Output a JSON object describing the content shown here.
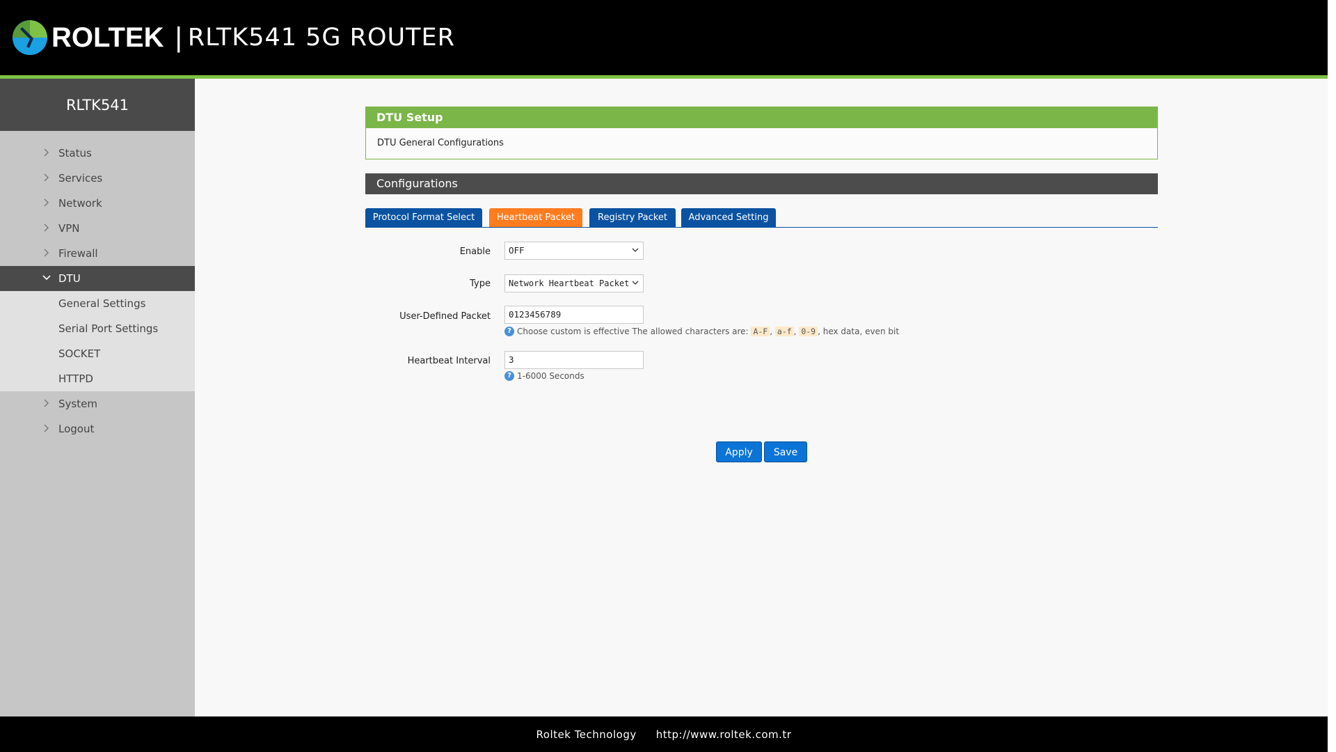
{
  "header": {
    "brand": "ROLTEK",
    "separator": "|",
    "model_title": "RLTK541  5G  ROUTER",
    "logo_icon": "roltek-logo-icon"
  },
  "sidebar": {
    "title": "RLTK541",
    "items": [
      {
        "label": "Status"
      },
      {
        "label": "Services"
      },
      {
        "label": "Network"
      },
      {
        "label": "VPN"
      },
      {
        "label": "Firewall"
      },
      {
        "label": "DTU"
      },
      {
        "label": "General Settings"
      },
      {
        "label": "Serial Port Settings"
      },
      {
        "label": "SOCKET"
      },
      {
        "label": "HTTPD"
      },
      {
        "label": "System"
      },
      {
        "label": "Logout"
      }
    ]
  },
  "panel": {
    "title": "DTU Setup",
    "subtitle": "DTU General Configurations"
  },
  "configurations": {
    "title": "Configurations",
    "tabs": [
      {
        "label": "Protocol Format Select"
      },
      {
        "label": "Heartbeat Packet"
      },
      {
        "label": "Registry Packet"
      },
      {
        "label": "Advanced Setting"
      }
    ],
    "active_tab": "Heartbeat Packet"
  },
  "form": {
    "enable": {
      "label": "Enable",
      "value": "OFF"
    },
    "type": {
      "label": "Type",
      "value": "Network Heartbeat Packet"
    },
    "user_packet": {
      "label": "User-Defined Packet",
      "value": "0123456789",
      "hint_prefix": "Choose custom is effective The allowed characters are:",
      "codes": [
        "A-F",
        "a-f",
        "0-9"
      ],
      "comma": ",",
      "hint_suffix": ", hex data, even bit"
    },
    "interval": {
      "label": "Heartbeat Interval",
      "value": "3",
      "hint": "1-6000 Seconds"
    }
  },
  "buttons": {
    "apply": "Apply",
    "save": "Save"
  },
  "footer": {
    "company": "Roltek Technology",
    "url": "http://www.roltek.com.tr"
  },
  "colors": {
    "accent_green": "#7ab648",
    "tab_blue": "#0b52a1",
    "tab_active_orange": "#ff7c1f",
    "button_blue": "#0b74d6"
  }
}
